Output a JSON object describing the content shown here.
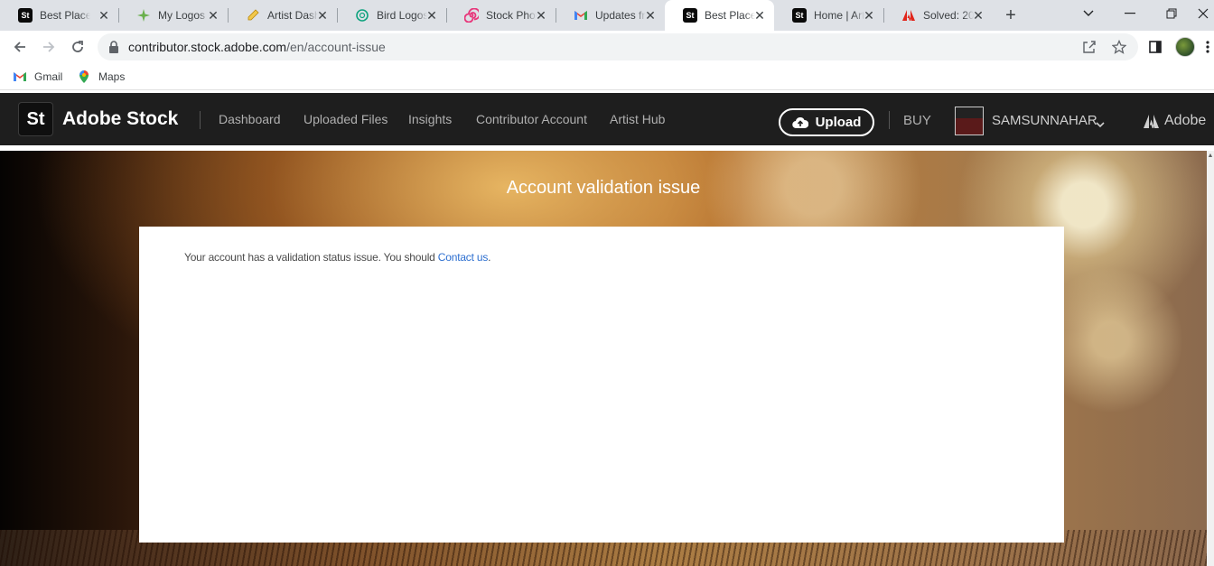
{
  "browser": {
    "tabs": [
      {
        "title": "Best Place",
        "icon": "adobe-stock-icon",
        "active": false
      },
      {
        "title": "My Logos",
        "icon": "sparkle-icon",
        "active": false
      },
      {
        "title": "Artist Dash",
        "icon": "pencil-icon",
        "active": false
      },
      {
        "title": "Bird Logos",
        "icon": "openai-icon",
        "active": false
      },
      {
        "title": "Stock Phot",
        "icon": "spiral-icon",
        "active": false
      },
      {
        "title": "Updates fr",
        "icon": "gmail-icon",
        "active": false
      },
      {
        "title": "Best Place",
        "icon": "adobe-stock-icon",
        "active": true
      },
      {
        "title": "Home | Art",
        "icon": "adobe-stock-icon",
        "active": false
      },
      {
        "title": "Solved: 20",
        "icon": "adobe-icon",
        "active": false
      }
    ],
    "url_host": "contributor.stock.adobe.com",
    "url_path": "/en/account-issue",
    "bookmarks": [
      {
        "label": "Gmail",
        "icon": "gmail-icon"
      },
      {
        "label": "Maps",
        "icon": "maps-icon"
      }
    ]
  },
  "site": {
    "logo_mark": "St",
    "brand": "Adobe Stock",
    "nav": [
      "Dashboard",
      "Uploaded Files",
      "Insights",
      "Contributor Account",
      "Artist Hub"
    ],
    "upload_label": "Upload",
    "buy_label": "BUY",
    "username": "SAMSUNNAHAR",
    "adobe_label": "Adobe"
  },
  "content": {
    "title": "Account validation issue",
    "message": "Your account has a validation status issue. You should",
    "link_text": "Contact us",
    "message_end": "."
  }
}
